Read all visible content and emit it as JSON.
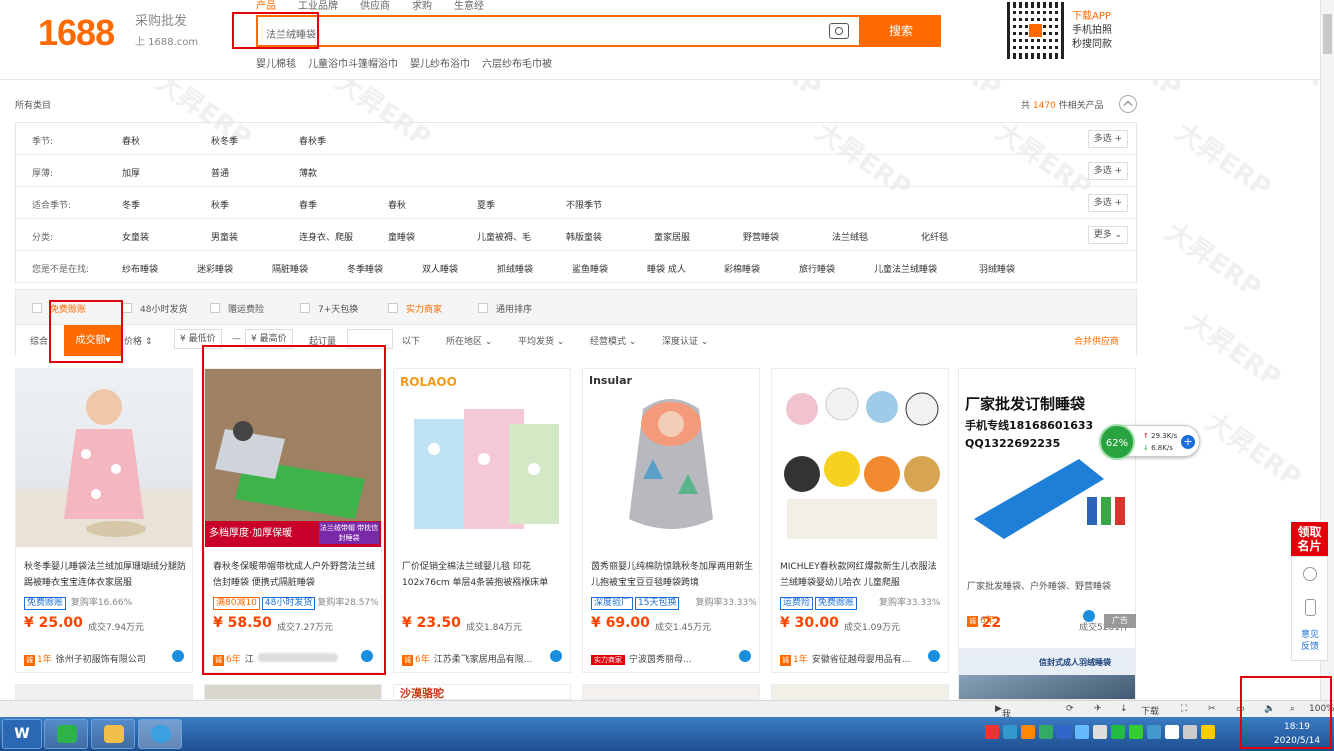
{
  "header": {
    "logo": "1688",
    "logo_sub": "采购批发",
    "logo_domain": "上 1688.com",
    "search_tabs": [
      "产品",
      "工业品牌",
      "供应商",
      "求购",
      "生意经"
    ],
    "search_value": "法兰绒睡袋",
    "search_button": "搜索",
    "hot_words": [
      "婴儿棉毯",
      "儿童浴巾斗篷帽浴巾",
      "婴儿纱布浴巾",
      "六层纱布毛巾被"
    ],
    "app_lines": [
      "下载APP",
      "手机拍照",
      "秒搜同款"
    ]
  },
  "breadcrumb": "所有类目",
  "results": {
    "prefix": "共",
    "count": "1470",
    "suffix": "件相关产品"
  },
  "filters": [
    {
      "label": "季节:",
      "options": [
        "春秋",
        "秋冬季",
        "春秋季"
      ],
      "action": "多选 +"
    },
    {
      "label": "厚薄:",
      "options": [
        "加厚",
        "普通",
        "薄款"
      ],
      "action": "多选 +"
    },
    {
      "label": "适合季节:",
      "options": [
        "冬季",
        "秋季",
        "春季",
        "春秋",
        "夏季",
        "不限季节"
      ],
      "action": "多选 +"
    },
    {
      "label": "分类:",
      "options": [
        "女童装",
        "男童装",
        "连身衣、爬服",
        "童睡袋",
        "儿童被褥、毛",
        "韩版童装",
        "童家居服",
        "野营睡袋",
        "法兰绒毯",
        "化纤毯"
      ],
      "action": "更多 ⌄"
    },
    {
      "label": "您是不是在找:",
      "options": [
        "纱布睡袋",
        "迷彩睡袋",
        "隔脏睡袋",
        "冬季睡袋",
        "双人睡袋",
        "抓绒睡袋",
        "鲨鱼睡袋",
        "睡袋 成人",
        "彩棉睡袋",
        "旅行睡袋",
        "儿童法兰绒睡袋",
        "羽绒睡袋"
      ],
      "action": ""
    }
  ],
  "sortbar": {
    "checks": [
      "免费赊账",
      "48小时发货",
      "赠运费险",
      "7+天包换",
      "实力商家",
      "通用排序"
    ],
    "sorts": [
      "综合",
      "成交额",
      "价格"
    ],
    "price_low": "¥ 最低价",
    "dash": "—",
    "price_high": "¥ 最高价",
    "moq": "起订量",
    "below": "以下",
    "dropdowns": [
      "所在地区",
      "平均发货",
      "经营模式",
      "深度认证"
    ],
    "merge": "合并供应商"
  },
  "products": [
    {
      "title": "秋冬季婴儿睡袋法兰绒加厚珊瑚绒分腿防踢被睡衣宝宝连体衣家居服",
      "tags": [
        "免费赊账"
      ],
      "repurchase": "复购率16.66%",
      "price": "¥ 25.00",
      "deal": "成交7.94万元",
      "years": "1年",
      "supplier": "徐州子初服饰有限公司",
      "ad": ""
    },
    {
      "title": "春秋冬保暖带帽带枕成人户外野营法兰绒信封睡袋 便携式隔脏睡袋",
      "tags": [
        "满80减10",
        "48小时发货"
      ],
      "repurchase": "复购率28.57%",
      "price": "¥ 58.50",
      "deal": "成交7.27万元",
      "years": "6年",
      "supplier": "江",
      "ad": ""
    },
    {
      "title": "厂价促销全棉法兰绒婴儿毯 印花102x76cm 单层4条装抱被襁褓床单",
      "tags": [],
      "repurchase": "",
      "price": "¥ 23.50",
      "deal": "成交1.84万元",
      "years": "6年",
      "supplier": "江苏柔飞家居用品有限...",
      "ad": ""
    },
    {
      "title": "茵秀丽婴儿纯棉防惊跳秋冬加厚两用新生儿抱被宝宝豆豆毯睡袋跨境",
      "tags": [
        "深度验厂",
        "15天包换"
      ],
      "repurchase": "复购率33.33%",
      "price": "¥ 69.00",
      "deal": "成交1.45万元",
      "years": "",
      "supplier": "宁波茵秀丽母...",
      "ad": ""
    },
    {
      "title": "MICHLEY春秋款网红爆款新生儿衣服法兰绒睡袋婴幼儿哈衣 儿童爬服",
      "tags": [
        "运费险",
        "免费赊账"
      ],
      "repurchase": "复购率33.33%",
      "price": "¥ 30.00",
      "deal": "成交1.09万元",
      "years": "1年",
      "supplier": "安徽省征越母婴用品有...",
      "ad": ""
    },
    {
      "title": "厂家批发睡袋、户外睡袋、野营睡袋",
      "tags": [],
      "repurchase": "",
      "price": "¥ 22",
      "deal": "成交5281件",
      "years": "6年",
      "supplier": "",
      "ad": "广告"
    }
  ],
  "images": {
    "p2_banner": "多档厚度·加厚保暖",
    "p2_badge": "法兰绒带帽 带枕信封睡袋",
    "p3_brand": "ROLAOO",
    "p4_brand": "Insular",
    "p6_head": "厂家批发订制睡袋",
    "p6_phone": "手机专线18168601633",
    "p6_qq": "QQ1322692235",
    "row2_a": "沙漠骆驼",
    "row2_b": "信封式成人羽绒睡袋"
  },
  "net_widget": {
    "percent": "62%",
    "up": "29.3K/s",
    "down": "6.8K/s",
    "plus": "+"
  },
  "side": {
    "card": "领取 名片",
    "feedback": "意见 反馈"
  },
  "statusbar": {
    "video": "我的视频",
    "download": "下载",
    "zoom": "100%"
  },
  "taskbar": {
    "time": "18:19",
    "date": "2020/5/14"
  },
  "watermark": "大昇ERP",
  "colors": {
    "brand": "#ff6a00",
    "highlight": "#e3000b",
    "link": "#1a6fd8"
  }
}
